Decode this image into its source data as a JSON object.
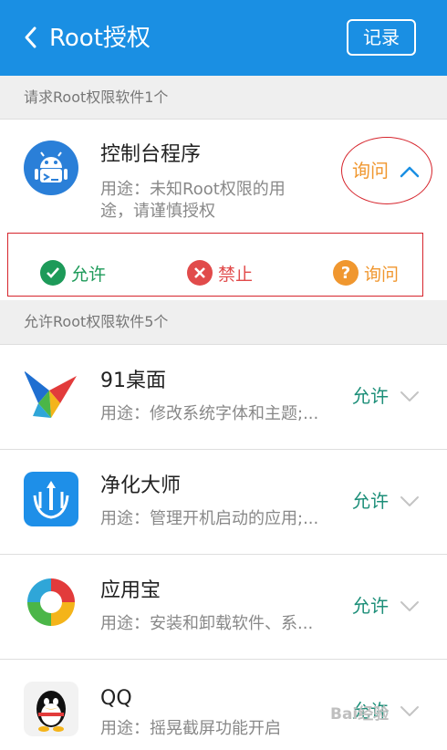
{
  "header": {
    "title": "Root授权",
    "record_label": "记录"
  },
  "section_request": "请求Root权限软件1个",
  "request_app": {
    "name": "控制台程序",
    "desc_line1": "用途：未知Root权限的用",
    "desc_line2": "途，请谨慎授权",
    "status": "询问"
  },
  "permission_options": [
    {
      "label": "允许",
      "icon": "check-icon",
      "color": "#1d9a59"
    },
    {
      "label": "禁止",
      "icon": "close-icon",
      "color": "#e14b4b"
    },
    {
      "label": "询问",
      "icon": "question-icon",
      "color": "#f0972f"
    }
  ],
  "section_allowed": "允许Root权限软件5个",
  "allowed_apps": [
    {
      "name": "91桌面",
      "desc": "用途：修改系统字体和主题;...",
      "status": "允许"
    },
    {
      "name": "净化大师",
      "desc": "用途：管理开机启动的应用;...",
      "status": "允许"
    },
    {
      "name": "应用宝",
      "desc": "用途：安装和卸载软件、系...",
      "status": "允许"
    },
    {
      "name": "QQ",
      "desc": "用途：摇晃截屏功能开启",
      "status": "允许"
    }
  ],
  "colors": {
    "header": "#1a8fe3",
    "allow": "#1d8f79",
    "ask": "#f0972f"
  },
  "watermark": "Bai经验"
}
